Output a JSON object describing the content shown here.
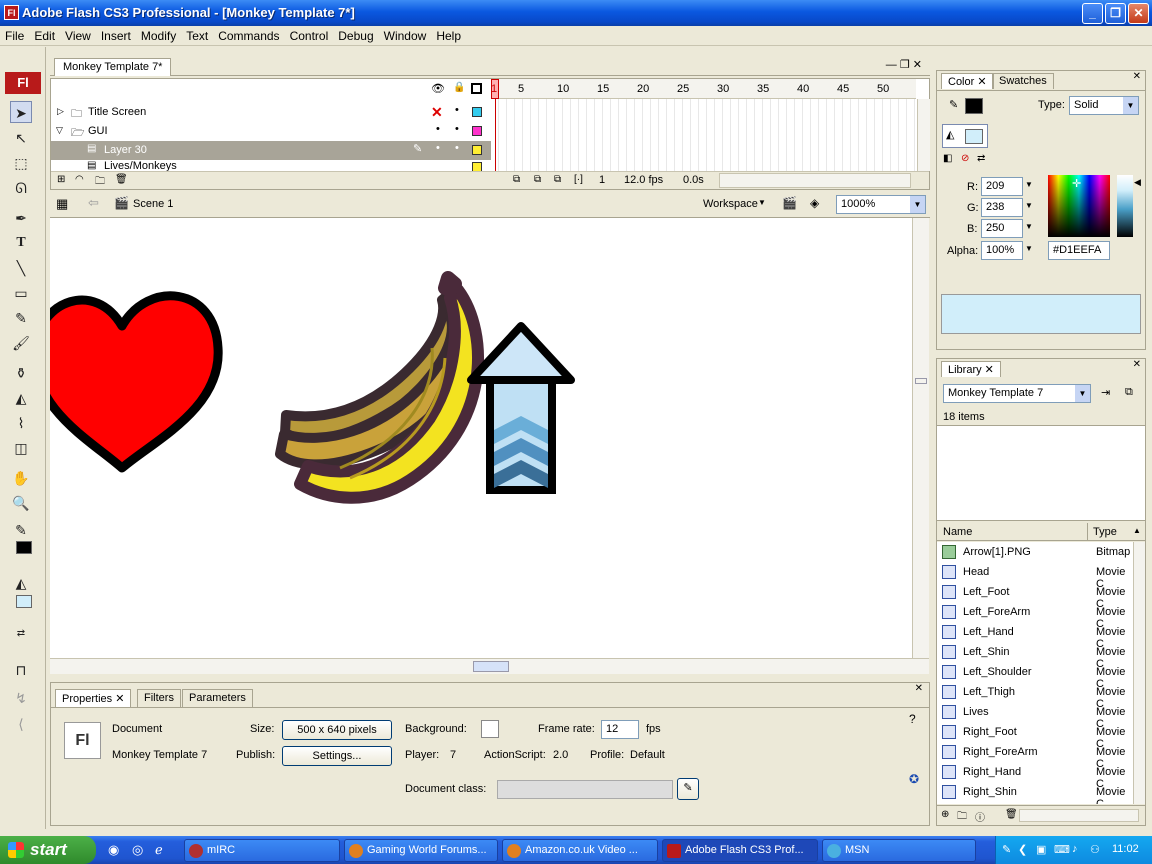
{
  "window": {
    "title": "Adobe Flash CS3 Professional - [Monkey Template 7*]",
    "app_icon": "Fl"
  },
  "menu": [
    "File",
    "Edit",
    "View",
    "Insert",
    "Modify",
    "Text",
    "Commands",
    "Control",
    "Debug",
    "Window",
    "Help"
  ],
  "document_tab": "Monkey Template 7*",
  "timeline": {
    "layers": [
      {
        "name": "Title Screen",
        "color": "#33ccee"
      },
      {
        "name": "GUI",
        "color": "#ff33cc"
      },
      {
        "name": "Layer 30",
        "color": "#ffee33"
      },
      {
        "name": "Lives/Monkeys",
        "color": "#ffee33"
      }
    ],
    "frame_numbers": [
      "1",
      "5",
      "10",
      "15",
      "20",
      "25",
      "30",
      "35",
      "40",
      "45",
      "50"
    ],
    "current_frame": "1",
    "fps": "12.0 fps",
    "time": "0.0s"
  },
  "editbar": {
    "scene": "Scene 1",
    "workspace": "Workspace",
    "zoom": "1000%"
  },
  "properties": {
    "tabs": [
      "Properties",
      "Filters",
      "Parameters"
    ],
    "doc_icon": "Fl",
    "doc_label": "Document",
    "doc_name": "Monkey Template 7",
    "size_label": "Size:",
    "size_value": "500 x 640 pixels",
    "publish_label": "Publish:",
    "settings_btn": "Settings...",
    "background_label": "Background:",
    "framerate_label": "Frame rate:",
    "framerate_value": "12",
    "fps_unit": "fps",
    "player_label": "Player:",
    "player_value": "7",
    "actionscript_label": "ActionScript:",
    "actionscript_value": "2.0",
    "profile_label": "Profile:",
    "profile_value": "Default",
    "doc_class_label": "Document class:"
  },
  "color_panel": {
    "tabs": [
      "Color",
      "Swatches"
    ],
    "type_label": "Type:",
    "type_value": "Solid",
    "r_label": "R:",
    "r": "209",
    "g_label": "G:",
    "g": "238",
    "b_label": "B:",
    "b": "250",
    "alpha_label": "Alpha:",
    "alpha": "100%",
    "hex": "#D1EEFA",
    "fill_color": "#d1eefa"
  },
  "library": {
    "title": "Library",
    "doc": "Monkey Template 7",
    "count": "18 items",
    "col_name": "Name",
    "col_type": "Type",
    "items": [
      {
        "name": "Arrow[1].PNG",
        "type": "Bitmap"
      },
      {
        "name": "Head",
        "type": "Movie C"
      },
      {
        "name": "Left_Foot",
        "type": "Movie C"
      },
      {
        "name": "Left_ForeArm",
        "type": "Movie C"
      },
      {
        "name": "Left_Hand",
        "type": "Movie C"
      },
      {
        "name": "Left_Shin",
        "type": "Movie C"
      },
      {
        "name": "Left_Shoulder",
        "type": "Movie C"
      },
      {
        "name": "Left_Thigh",
        "type": "Movie C"
      },
      {
        "name": "Lives",
        "type": "Movie C"
      },
      {
        "name": "Right_Foot",
        "type": "Movie C"
      },
      {
        "name": "Right_ForeArm",
        "type": "Movie C"
      },
      {
        "name": "Right_Hand",
        "type": "Movie C"
      },
      {
        "name": "Right_Shin",
        "type": "Movie C"
      }
    ]
  },
  "taskbar": {
    "start": "start",
    "tasks": [
      "mIRC",
      "Gaming World Forums...",
      "Amazon.co.uk Video ...",
      "Adobe Flash CS3 Prof...",
      "MSN"
    ],
    "clock": "11:02"
  }
}
